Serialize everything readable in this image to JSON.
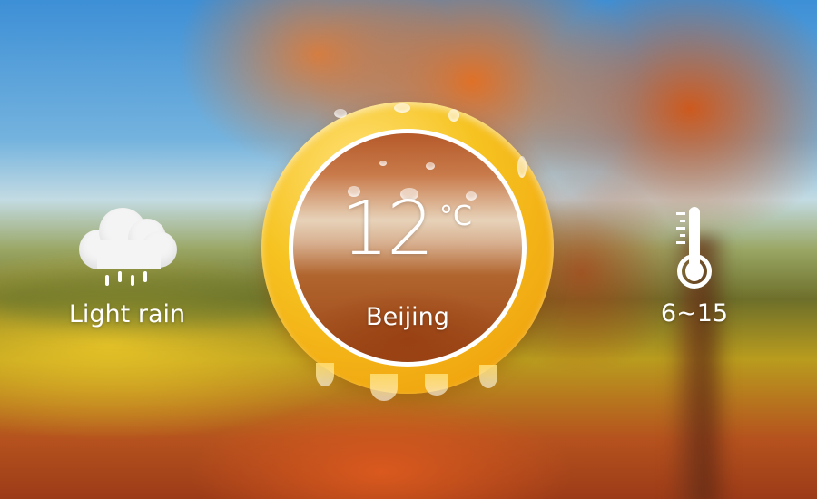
{
  "weather": {
    "condition": "Light rain",
    "condition_icon": "rain-cloud-icon",
    "temperature": "12",
    "temperature_unit": "°C",
    "city": "Beijing",
    "range": "6~15",
    "range_icon": "thermometer-icon"
  },
  "colors": {
    "ring": "#f6c321",
    "text": "#ffffff"
  }
}
